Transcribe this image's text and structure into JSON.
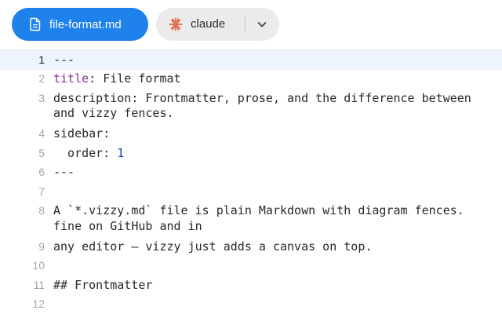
{
  "tabs": {
    "file": {
      "label": "file-format.md",
      "icon": "document-icon",
      "color": "#1f82ec"
    },
    "model": {
      "label": "claude",
      "icon": "claude-spark-icon",
      "dropdown_icon": "chevron-down-icon",
      "accent": "#e2734f"
    }
  },
  "editor": {
    "lines": [
      {
        "number": "1",
        "active": true,
        "segments": [
          {
            "text": "---"
          }
        ]
      },
      {
        "number": "2",
        "segments": [
          {
            "text": "title",
            "type": "key"
          },
          {
            "text": ": File format"
          }
        ]
      },
      {
        "number": "3",
        "segments": [
          {
            "text": "description: Frontmatter, prose, and the difference between"
          }
        ],
        "wrap": "and vizzy fences."
      },
      {
        "number": "4",
        "segments": [
          {
            "text": "sidebar:"
          }
        ]
      },
      {
        "number": "5",
        "segments": [
          {
            "text": "  order: "
          },
          {
            "text": "1",
            "type": "num"
          }
        ]
      },
      {
        "number": "6",
        "segments": [
          {
            "text": "---"
          }
        ]
      },
      {
        "number": "7",
        "segments": [
          {
            "text": ""
          }
        ]
      },
      {
        "number": "8",
        "segments": [
          {
            "text": "A `*.vizzy.md` file is plain Markdown with diagram fences."
          }
        ],
        "wrap": "fine on GitHub and in"
      },
      {
        "number": "9",
        "segments": [
          {
            "text": "any editor — vizzy just adds a canvas on top."
          }
        ]
      },
      {
        "number": "10",
        "segments": [
          {
            "text": ""
          }
        ]
      },
      {
        "number": "11",
        "segments": [
          {
            "text": "## Frontmatter"
          }
        ]
      },
      {
        "number": "12",
        "segments": [
          {
            "text": ""
          }
        ]
      }
    ]
  }
}
